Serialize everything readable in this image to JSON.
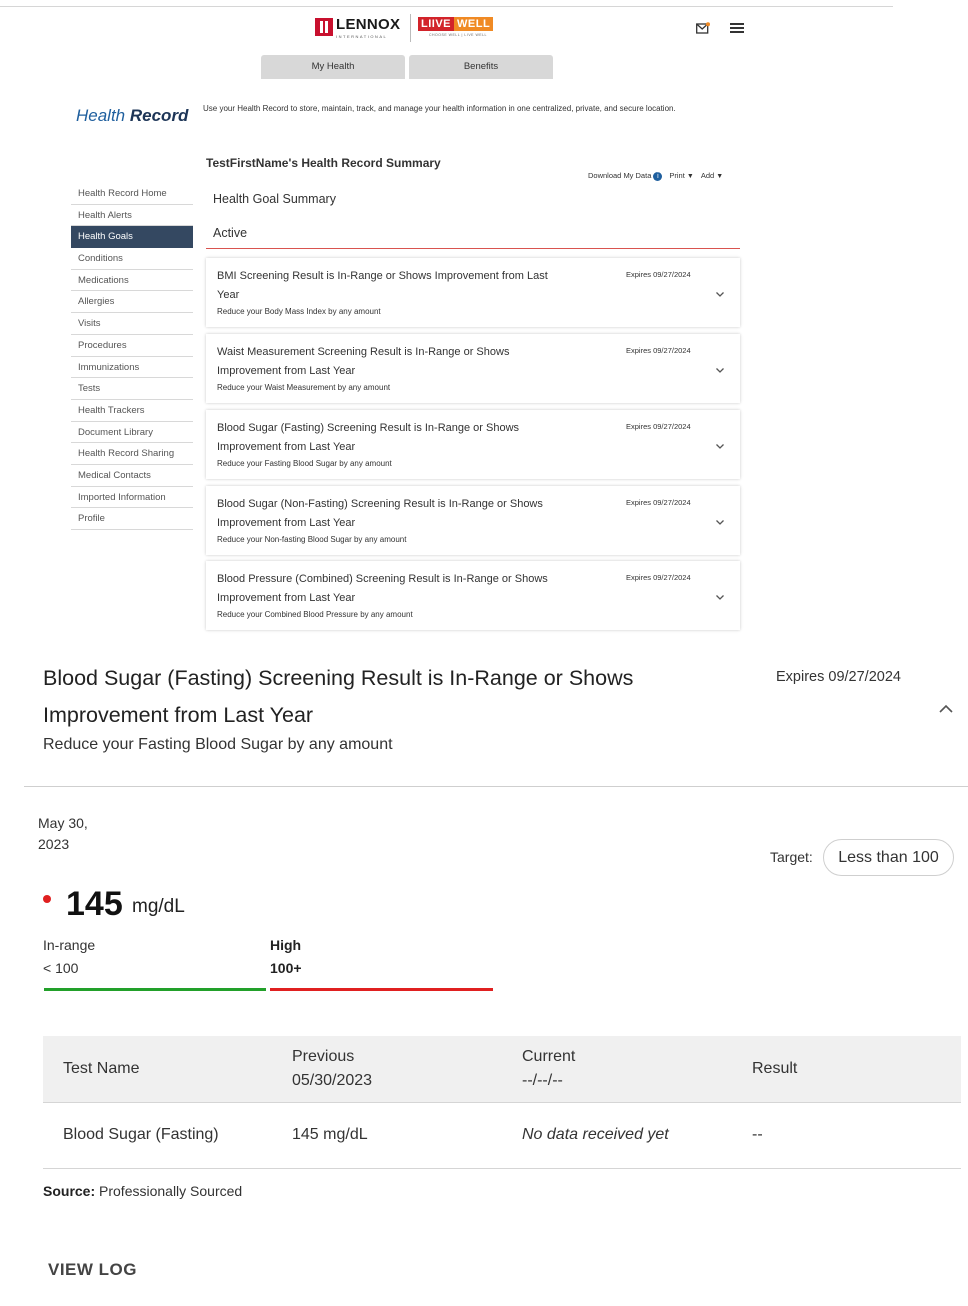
{
  "header": {
    "brand_lennox": "LENNOX",
    "brand_lennox_sub": "INTERNATIONAL",
    "brand_liive_a": "LIIVE",
    "brand_liive_b": "WELL",
    "brand_liive_tag": "CHOOSE WELL | LIVE WELL",
    "icons": [
      "mail-notification-icon",
      "hamburger-menu-icon"
    ],
    "tabs": [
      "My Health",
      "Benefits"
    ]
  },
  "health_record": {
    "title_a": "Health",
    "title_b": "Record",
    "description": "Use your Health Record to store, maintain, track, and manage your health information in one centralized, private, and secure location.",
    "summary_title": "TestFirstName's Health Record Summary",
    "actions": {
      "download": "Download My Data",
      "print": "Print",
      "add": "Add"
    }
  },
  "sidebar": {
    "items": [
      "Health Record Home",
      "Health Alerts",
      "Health Goals",
      "Conditions",
      "Medications",
      "Allergies",
      "Visits",
      "Procedures",
      "Immunizations",
      "Tests",
      "Health Trackers",
      "Document Library",
      "Health Record Sharing",
      "Medical Contacts",
      "Imported Information",
      "Profile"
    ],
    "active": "Health Goals"
  },
  "goals": {
    "summary_label": "Health Goal Summary",
    "status_label": "Active",
    "cards": [
      {
        "title": "BMI Screening Result is In-Range or Shows Improvement from Last Year",
        "subtitle": "Reduce your Body Mass Index by any amount",
        "expires": "Expires 09/27/2024"
      },
      {
        "title": "Waist Measurement Screening Result is In-Range or Shows Improvement from Last Year",
        "subtitle": "Reduce your Waist Measurement by any amount",
        "expires": "Expires 09/27/2024"
      },
      {
        "title": "Blood Sugar (Fasting) Screening Result is In-Range or Shows Improvement from Last Year",
        "subtitle": "Reduce your Fasting Blood Sugar by any amount",
        "expires": "Expires 09/27/2024"
      },
      {
        "title": "Blood Sugar (Non-Fasting) Screening Result is In-Range or Shows Improvement from Last Year",
        "subtitle": "Reduce your Non-fasting Blood Sugar by any amount",
        "expires": "Expires 09/27/2024"
      },
      {
        "title": "Blood Pressure (Combined) Screening Result is In-Range or Shows Improvement from Last Year",
        "subtitle": "Reduce your Combined Blood Pressure by any amount",
        "expires": "Expires 09/27/2024"
      }
    ]
  },
  "detail": {
    "title": "Blood Sugar (Fasting) Screening Result is In-Range or Shows Improvement from Last Year",
    "expires": "Expires 09/27/2024",
    "subtitle": "Reduce your Fasting Blood Sugar by any amount",
    "date": "May 30, 2023",
    "target_label": "Target:",
    "target_value": "Less than 100",
    "value": "145",
    "unit": "mg/dL",
    "status_color": "#e02020",
    "ranges": [
      {
        "label": "In-range",
        "value": "< 100",
        "color": "#22a02a"
      },
      {
        "label": "High",
        "value": "100+",
        "color": "#e02020"
      }
    ],
    "table": {
      "headers": {
        "test_name": "Test Name",
        "previous": "Previous",
        "previous_date": "05/30/2023",
        "current": "Current",
        "current_date": "--/--/--",
        "result": "Result"
      },
      "rows": [
        {
          "test_name": "Blood Sugar (Fasting)",
          "previous": "145 mg/dL",
          "current": "No data received yet",
          "result": "--"
        }
      ]
    },
    "source_label": "Source:",
    "source_value": "Professionally Sourced",
    "view_log": "VIEW LOG"
  }
}
